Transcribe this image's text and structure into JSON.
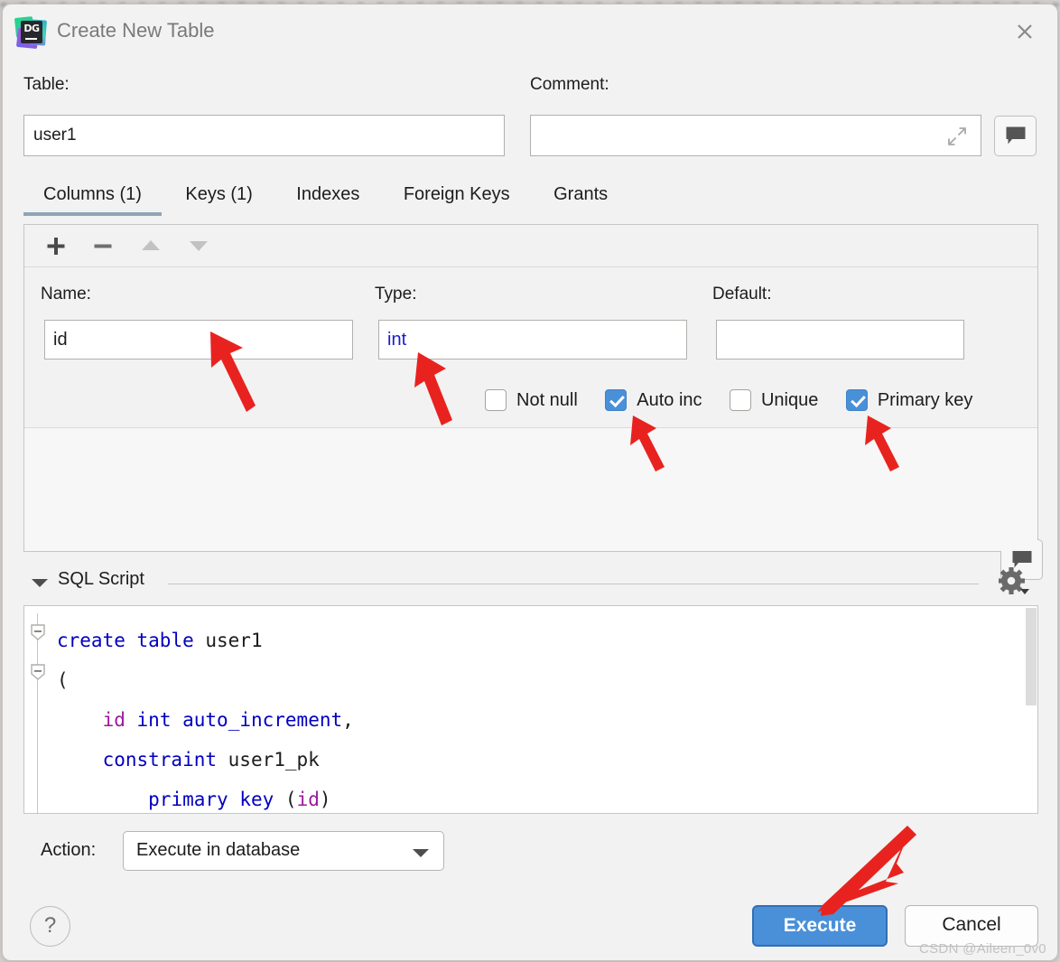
{
  "window": {
    "title": "Create New Table",
    "app_icon": "datagrip-icon",
    "app_icon_text": "DG",
    "close_icon": "close-icon"
  },
  "form": {
    "table_label": "Table:",
    "table_value": "user1",
    "table_placeholder": "",
    "comment_label": "Comment:",
    "comment_value": "",
    "comment_placeholder": "",
    "expand_icon": "expand-icon",
    "comment_button_icon": "comment-bubble-icon"
  },
  "tabs": [
    {
      "label": "Columns (1)",
      "active": true
    },
    {
      "label": "Keys (1)",
      "active": false
    },
    {
      "label": "Indexes",
      "active": false
    },
    {
      "label": "Foreign Keys",
      "active": false
    },
    {
      "label": "Grants",
      "active": false
    }
  ],
  "toolbar": {
    "add_icon": "plus-icon",
    "remove_icon": "minus-icon",
    "move_up_icon": "triangle-up-icon",
    "move_down_icon": "triangle-down-icon"
  },
  "column": {
    "name_label": "Name:",
    "name_value": "id",
    "type_label": "Type:",
    "type_value": "int",
    "default_label": "Default:",
    "default_value": "",
    "default_button_icon": "comment-bubble-icon",
    "checkboxes": [
      {
        "label": "Not null",
        "checked": false
      },
      {
        "label": "Auto inc",
        "checked": true
      },
      {
        "label": "Unique",
        "checked": false
      },
      {
        "label": "Primary key",
        "checked": true
      }
    ]
  },
  "sql_section": {
    "title": "SQL Script",
    "collapse_icon": "triangle-down-icon",
    "settings_icon": "gear-icon",
    "code_lines": [
      {
        "tokens": [
          {
            "t": "create",
            "c": "kw"
          },
          {
            "t": " ",
            "c": ""
          },
          {
            "t": "table",
            "c": "kw"
          },
          {
            "t": " user1",
            "c": ""
          }
        ]
      },
      {
        "tokens": [
          {
            "t": "(",
            "c": ""
          }
        ]
      },
      {
        "tokens": [
          {
            "t": "    ",
            "c": ""
          },
          {
            "t": "id",
            "c": "id"
          },
          {
            "t": " ",
            "c": ""
          },
          {
            "t": "int",
            "c": "kw"
          },
          {
            "t": " ",
            "c": ""
          },
          {
            "t": "auto_increment",
            "c": "kw"
          },
          {
            "t": ",",
            "c": ""
          }
        ]
      },
      {
        "tokens": [
          {
            "t": "    ",
            "c": ""
          },
          {
            "t": "constraint",
            "c": "kw"
          },
          {
            "t": " user1_pk",
            "c": ""
          }
        ]
      },
      {
        "tokens": [
          {
            "t": "        ",
            "c": ""
          },
          {
            "t": "primary",
            "c": "kw"
          },
          {
            "t": " ",
            "c": ""
          },
          {
            "t": "key",
            "c": "kw"
          },
          {
            "t": " (",
            "c": ""
          },
          {
            "t": "id",
            "c": "id"
          },
          {
            "t": ")",
            "c": ""
          }
        ]
      }
    ]
  },
  "footer": {
    "action_label": "Action:",
    "action_value": "Execute in database",
    "action_options": [
      "Execute in database"
    ],
    "help_label": "?",
    "execute_label": "Execute",
    "cancel_label": "Cancel",
    "watermark": "CSDN @Aileen_0v0"
  },
  "colors": {
    "accent": "#4a90d9",
    "annotation": "#e8231f",
    "tab_underline": "#90a4b8",
    "keyword": "#0000c0",
    "identifier": "#9b1a9b",
    "dialog_bg": "#f2f2f2"
  }
}
